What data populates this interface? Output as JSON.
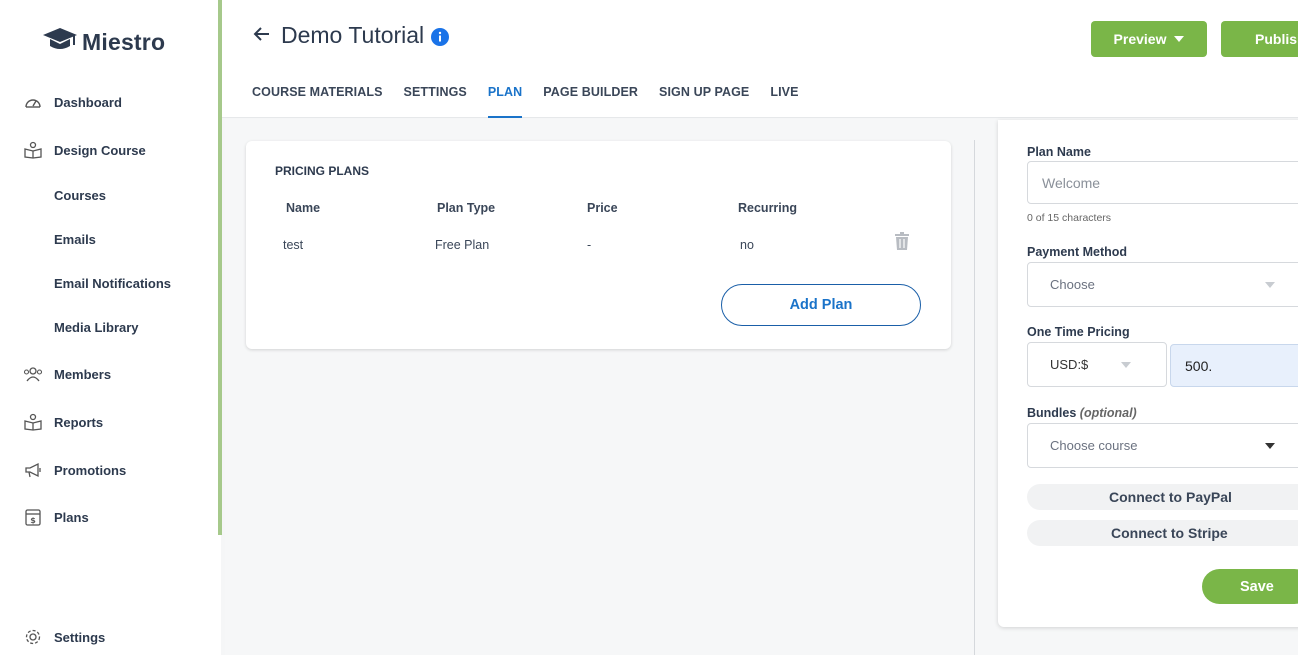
{
  "brand": {
    "name": "Miestro",
    "accent": "#7ab648",
    "link": "#1a73c9"
  },
  "sidebar": {
    "items": [
      {
        "label": "Dashboard",
        "icon": "dashboard-icon"
      },
      {
        "label": "Design Course",
        "icon": "design-course-icon"
      },
      {
        "label": "Courses"
      },
      {
        "label": "Emails"
      },
      {
        "label": "Email Notifications"
      },
      {
        "label": "Media Library"
      },
      {
        "label": "Members",
        "icon": "members-icon"
      },
      {
        "label": "Reports",
        "icon": "reports-icon"
      },
      {
        "label": "Promotions",
        "icon": "megaphone-icon"
      },
      {
        "label": "Plans",
        "icon": "plans-icon"
      },
      {
        "label": "Settings",
        "icon": "gear-icon"
      }
    ]
  },
  "header": {
    "title": "Demo Tutorial",
    "preview_label": "Preview",
    "publish_label": "Publish",
    "tabs": [
      {
        "label": "COURSE MATERIALS"
      },
      {
        "label": "SETTINGS"
      },
      {
        "label": "PLAN",
        "active": true
      },
      {
        "label": "PAGE BUILDER"
      },
      {
        "label": "SIGN UP PAGE"
      },
      {
        "label": "LIVE"
      }
    ]
  },
  "pricing": {
    "title": "PRICING PLANS",
    "columns": [
      "Name",
      "Plan Type",
      "Price",
      "Recurring"
    ],
    "rows": [
      {
        "name": "test",
        "plan_type": "Free Plan",
        "price": "-",
        "recurring": "no"
      }
    ],
    "add_label": "Add Plan"
  },
  "form": {
    "plan_name_label": "Plan Name",
    "plan_name_placeholder": "Welcome",
    "plan_name_hint": "0 of 15 characters",
    "payment_method_label": "Payment Method",
    "payment_method_value": "Choose",
    "one_time_label": "One Time Pricing",
    "currency_value": "USD:$",
    "amount_value": "500.",
    "bundles_label": "Bundles",
    "bundles_optional": "(optional)",
    "bundles_value": "Choose course",
    "paypal_label": "Connect to PayPal",
    "stripe_label": "Connect to Stripe",
    "save_label": "Save"
  }
}
